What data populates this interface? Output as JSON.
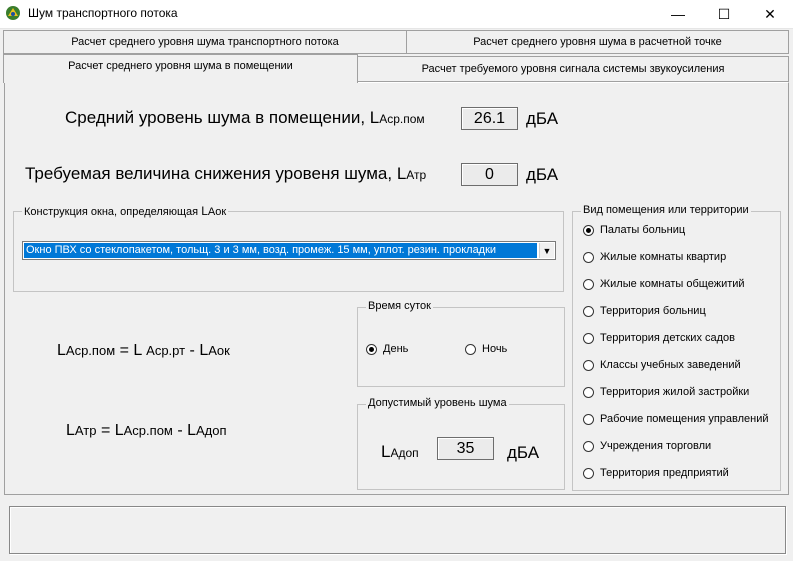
{
  "window": {
    "title": "Шум транспортного потока",
    "minimize": "—",
    "maximize": "☐",
    "close": "✕"
  },
  "tabs": {
    "row1": [
      "Расчет среднего уровня шума транспортного потока",
      "Расчет среднего уровня шума в расчетной точке"
    ],
    "row2": [
      "Расчет среднего уровня шума в помещении",
      "Расчет требуемого уровня сигнала системы звукоусиления"
    ],
    "active": "Расчет среднего уровня шума в помещении"
  },
  "noise_level": {
    "label": "Средний уровень шума в помещении,",
    "symbol": "L",
    "subscript": "Асp.пом",
    "value": "26.1",
    "unit": "дБА"
  },
  "reduction": {
    "label": "Требуемая величина снижения уровеня шума,",
    "symbol": "L",
    "subscript": "Атр",
    "value": "0",
    "unit": "дБА"
  },
  "window_construction": {
    "legend": "Конструкция окна, определяющая",
    "legend_symbol": "L",
    "legend_subscript": "Аок",
    "selected": "Окно ПВХ со стеклопакетом, тольщ. 3 и 3 мм, возд. промеж. 15 мм, уплот. резин. прокладки",
    "arrow": "▼"
  },
  "time_of_day": {
    "legend": "Время суток",
    "options": [
      "День",
      "Ночь"
    ],
    "selected": "День"
  },
  "allowed_level": {
    "legend": "Допустимый уровень шума",
    "symbol": "L",
    "subscript": "Адоп",
    "value": "35",
    "unit": "дБА"
  },
  "formula1": {
    "l1": "L",
    "s1": "Аср.пом",
    "eq": "=",
    "l2": "L",
    "s2": "Аср.рт",
    "minus": "-",
    "l3": "L",
    "s3": "Аок"
  },
  "formula2": {
    "l1": "L",
    "s1": "Атр",
    "eq": "=",
    "l2": "L",
    "s2": "Аср.пом",
    "minus": "-",
    "l3": "L",
    "s3": "Адоп"
  },
  "room_type": {
    "legend": "Вид помещения или территории",
    "options": [
      "Палаты больниц",
      "Жилые комнаты квартир",
      "Жилые комнаты общежитий",
      "Территория больниц",
      "Территория детских садов",
      "Классы учебных заведений",
      "Территория жилой застройки",
      "Рабочие помещения управлений",
      "Учреждения торговли",
      "Территория предприятий"
    ],
    "selected_index": 0
  },
  "colors": {
    "selection": "#0078d7",
    "background": "#f0f0f0"
  },
  "icons": {
    "app": "app-logo-icon"
  }
}
